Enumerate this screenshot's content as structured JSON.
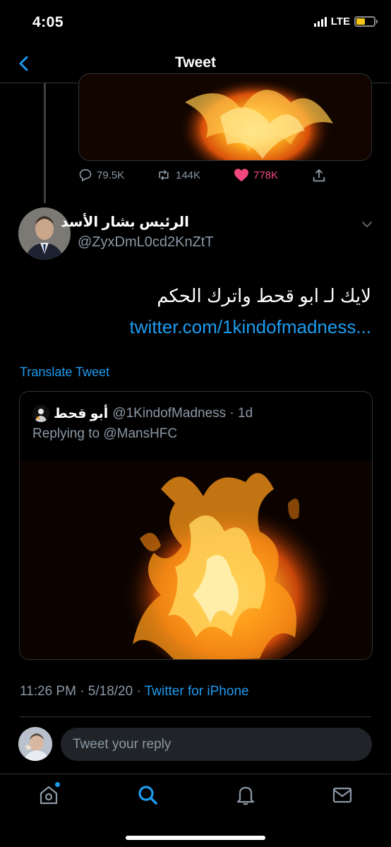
{
  "status_bar": {
    "time": "4:05",
    "network": "LTE",
    "battery_level": 0.48,
    "battery_color": "#f5c518"
  },
  "header": {
    "title": "Tweet",
    "back_icon": "chevron-left-icon"
  },
  "parent_tweet": {
    "actions": {
      "replies": "79.5K",
      "retweets": "144K",
      "likes": "778K"
    },
    "like_color": "#f2477d",
    "reply_icon": "reply-icon",
    "retweet_icon": "retweet-icon",
    "like_icon": "heart-icon",
    "share_icon": "share-icon"
  },
  "tweet": {
    "author_name": "الرئيس بشار الأسد",
    "author_handle": "@ZyxDmL0cd2KnZtT",
    "text": "لايك لـ ابو قحط واترك الحكم",
    "link": "twitter.com/1kindofmadness...",
    "translate": "Translate Tweet",
    "timestamp": "11:26 PM · 5/18/20 · ",
    "source": "Twitter for iPhone"
  },
  "quoted_tweet": {
    "name": "أبو قحط",
    "handle": "@1KindofMadness · 1d",
    "replying_to": "Replying to @MansHFC"
  },
  "reply_bar": {
    "placeholder": "Tweet your reply"
  },
  "tab_bar": {
    "items": [
      "home-icon",
      "search-icon",
      "notifications-icon",
      "messages-icon"
    ],
    "active": "search-icon",
    "accent": "#1d9bf0"
  }
}
